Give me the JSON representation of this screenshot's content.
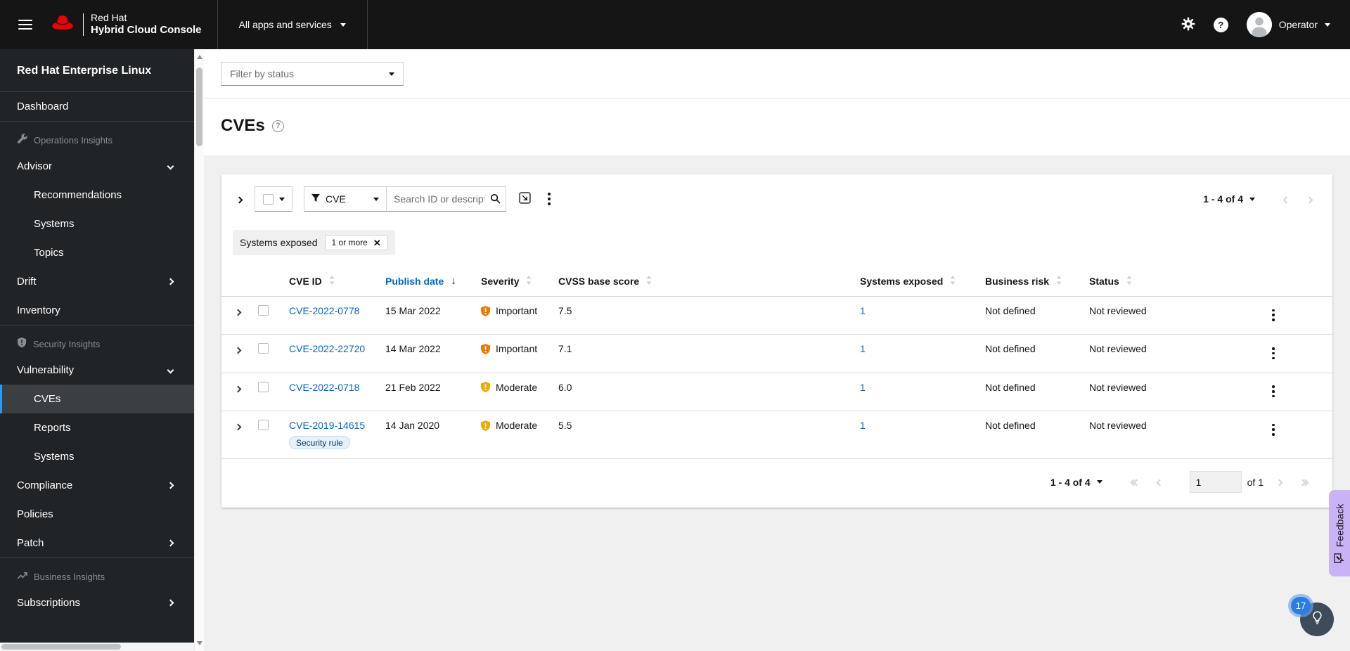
{
  "masthead": {
    "brand_line1": "Red Hat",
    "brand_line2": "Hybrid Cloud Console",
    "app_switcher_label": "All apps and services",
    "username": "Operator"
  },
  "sidebar": {
    "title": "Red Hat Enterprise Linux",
    "items": [
      {
        "type": "link",
        "label": "Dashboard"
      },
      {
        "type": "divider"
      },
      {
        "type": "section",
        "label": "Operations Insights",
        "icon": "wrench-icon"
      },
      {
        "type": "expandable",
        "label": "Advisor",
        "expanded": true
      },
      {
        "type": "sub",
        "label": "Recommendations"
      },
      {
        "type": "sub",
        "label": "Systems"
      },
      {
        "type": "sub",
        "label": "Topics"
      },
      {
        "type": "expandable",
        "label": "Drift",
        "expanded": false
      },
      {
        "type": "link",
        "label": "Inventory"
      },
      {
        "type": "divider"
      },
      {
        "type": "section",
        "label": "Security Insights",
        "icon": "shield-icon"
      },
      {
        "type": "expandable",
        "label": "Vulnerability",
        "expanded": true
      },
      {
        "type": "sub",
        "label": "CVEs",
        "active": true
      },
      {
        "type": "sub",
        "label": "Reports"
      },
      {
        "type": "sub",
        "label": "Systems"
      },
      {
        "type": "expandable",
        "label": "Compliance",
        "expanded": false
      },
      {
        "type": "link",
        "label": "Policies"
      },
      {
        "type": "expandable",
        "label": "Patch",
        "expanded": false
      },
      {
        "type": "divider"
      },
      {
        "type": "section",
        "label": "Business Insights",
        "icon": "trend-icon"
      },
      {
        "type": "expandable",
        "label": "Subscriptions",
        "expanded": false
      }
    ]
  },
  "filter_bar": {
    "status_placeholder": "Filter by status"
  },
  "page": {
    "title": "CVEs"
  },
  "toolbar": {
    "filter_type_label": "CVE",
    "search_placeholder": "Search ID or description",
    "pagination_label": "1 - 4 of 4"
  },
  "active_filters": {
    "group_label": "Systems exposed",
    "chips": [
      "1 or more"
    ]
  },
  "table": {
    "columns": [
      "CVE ID",
      "Publish date",
      "Severity",
      "CVSS base score",
      "Systems exposed",
      "Business risk",
      "Status"
    ],
    "sorted_by": "Publish date",
    "sort_direction": "descending",
    "severity_colors": {
      "Important": "#ec7a08",
      "Moderate": "#f0ab00"
    },
    "rows": [
      {
        "cve_id": "CVE-2022-0778",
        "publish_date": "15 Mar 2022",
        "severity": "Important",
        "cvss_base_score": "7.5",
        "systems_exposed": "1",
        "business_risk": "Not defined",
        "status": "Not reviewed",
        "badges": []
      },
      {
        "cve_id": "CVE-2022-22720",
        "publish_date": "14 Mar 2022",
        "severity": "Important",
        "cvss_base_score": "7.1",
        "systems_exposed": "1",
        "business_risk": "Not defined",
        "status": "Not reviewed",
        "badges": []
      },
      {
        "cve_id": "CVE-2022-0718",
        "publish_date": "21 Feb 2022",
        "severity": "Moderate",
        "cvss_base_score": "6.0",
        "systems_exposed": "1",
        "business_risk": "Not defined",
        "status": "Not reviewed",
        "badges": []
      },
      {
        "cve_id": "CVE-2019-14615",
        "publish_date": "14 Jan 2020",
        "severity": "Moderate",
        "cvss_base_score": "5.5",
        "systems_exposed": "1",
        "business_risk": "Not defined",
        "status": "Not reviewed",
        "badges": [
          "Security rule"
        ]
      }
    ]
  },
  "pagination_bottom": {
    "range_label": "1 - 4 of 4",
    "current_page": "1",
    "of_label": "of 1"
  },
  "feedback": {
    "label": "Feedback"
  },
  "assistant": {
    "badge_count": "17"
  },
  "colors": {
    "link_blue": "#0066cc",
    "nav_active_indicator": "#2b9af3",
    "severity_important": "#ec7a08",
    "severity_moderate": "#f0ab00",
    "feedback_background": "#c9b3f6",
    "assistant_badge": "#2b7de1"
  }
}
